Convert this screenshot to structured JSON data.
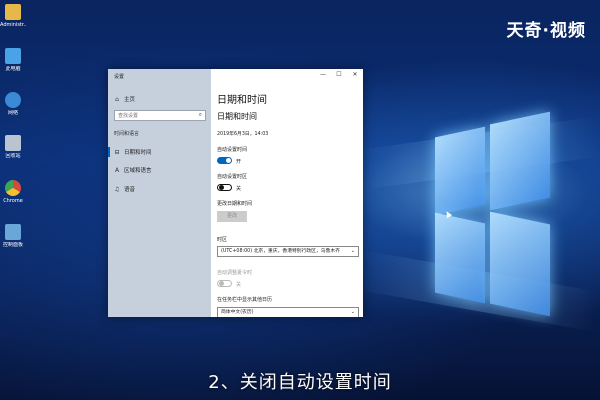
{
  "watermark": "天奇·视频",
  "desktop_icons": [
    {
      "label": "Administr...",
      "icon": "user-folder-icon",
      "color": "#e6b84a"
    },
    {
      "label": "此电脑",
      "icon": "computer-icon",
      "color": "#4aa3e6"
    },
    {
      "label": "网络",
      "icon": "network-icon",
      "color": "#3a8ad6"
    },
    {
      "label": "回收站",
      "icon": "recycle-bin-icon",
      "color": "#b8c4d0"
    },
    {
      "label": "Chrome",
      "icon": "chrome-icon",
      "color": "#d64a3a"
    },
    {
      "label": "控制面板",
      "icon": "control-panel-icon",
      "color": "#6aa6d8"
    }
  ],
  "window": {
    "title": "设置",
    "buttons": {
      "minimize": "—",
      "maximize": "☐",
      "close": "✕"
    }
  },
  "sidebar": {
    "home": "主页",
    "search_placeholder": "查找设置",
    "section": "时间和语言",
    "items": [
      {
        "label": "日期和时间",
        "icon": "calendar-clock-icon",
        "glyph": "⊟"
      },
      {
        "label": "区域和语言",
        "icon": "region-language-icon",
        "glyph": "A"
      },
      {
        "label": "语音",
        "icon": "microphone-icon",
        "glyph": "♫"
      }
    ]
  },
  "main": {
    "page_title": "日期和时间",
    "section_title": "日期和时间",
    "current_datetime": "2019年6月3日，14:03",
    "auto_time_label": "自动设置时间",
    "auto_time_state": "开",
    "auto_timezone_label": "自动设置时区",
    "auto_timezone_state": "关",
    "change_datetime_label": "更改日期和时间",
    "change_button": "更改",
    "timezone_label": "时区",
    "timezone_value": "(UTC+08:00) 北京，重庆，香港特别行政区，乌鲁木齐",
    "dst_label": "自动调整夏令时",
    "dst_state": "关",
    "calendar_label": "在任务栏中显示其他日历",
    "calendar_value": "简体中文(农历)"
  },
  "subtitle": "2、关闭自动设置时间",
  "colors": {
    "accent": "#0067c0",
    "sidebar_bg": "#c5d0dc"
  }
}
